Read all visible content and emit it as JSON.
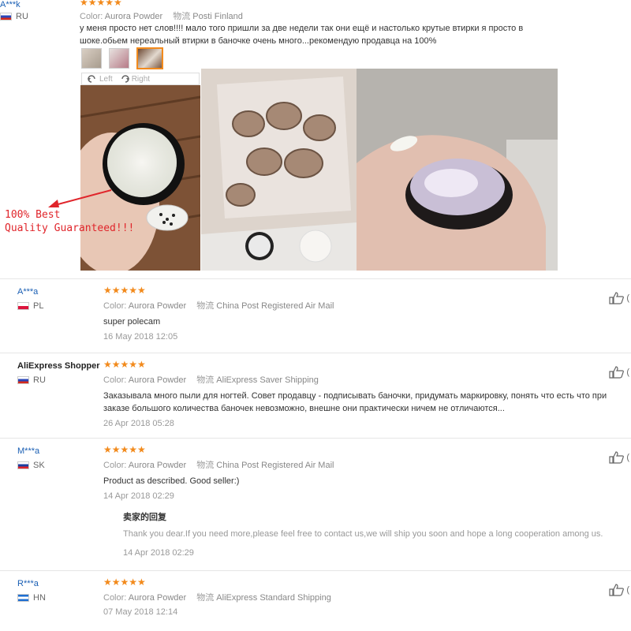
{
  "top_review": {
    "user": "A***k",
    "country": "RU",
    "stars": "★★★★★",
    "color_label": "Color:",
    "color": "Aurora Powder",
    "shipping_label": "物流",
    "shipping": "Posti Finland",
    "text": "у меня просто нет слов!!!! мало того пришли за две недели так они ещё и настолько крутые втирки я просто в шоке.обьем нереальный втирки в баночке очень много...рекомендую продавца на 100%",
    "rotate_left": "Left",
    "rotate_right": "Right"
  },
  "promo": {
    "line1": "100% Best",
    "line2": "Quality Guaranteed!!!"
  },
  "reviews": [
    {
      "user": "A***a",
      "country": "PL",
      "stars": "★★★★★",
      "color_label": "Color:",
      "color": "Aurora Powder",
      "shipping_label": "物流",
      "shipping": "China Post Registered Air Mail",
      "text": "super polecam",
      "date": "16 May 2018 12:05"
    },
    {
      "user": "AliExpress Shopper",
      "country": "RU",
      "stars": "★★★★★",
      "color_label": "Color:",
      "color": "Aurora Powder",
      "shipping_label": "物流",
      "shipping": "AliExpress Saver Shipping",
      "text": "Заказывала много пыли для ногтей. Совет продавцу - подписывать баночки, придумать маркировку, понять что есть что при заказе большого количества баночек невозможно, внешне они практически ничем не отличаются...",
      "date": "26 Apr 2018 05:28"
    },
    {
      "user": "M***a",
      "country": "SK",
      "stars": "★★★★★",
      "color_label": "Color:",
      "color": "Aurora Powder",
      "shipping_label": "物流",
      "shipping": "China Post Registered Air Mail",
      "text": "Product as described. Good seller:)",
      "date": "14 Apr 2018 02:29",
      "reply_title": "卖家的回复",
      "reply_text": "Thank you dear.If you need more,please feel free to contact us,we will ship you soon and hope a long cooperation among us.",
      "reply_date": "14 Apr 2018 02:29"
    },
    {
      "user": "R***a",
      "country": "HN",
      "stars": "★★★★★",
      "color_label": "Color:",
      "color": "Aurora Powder",
      "shipping_label": "物流",
      "shipping": "AliExpress Standard Shipping",
      "date": "07 May 2018 12:14"
    }
  ],
  "like_count": "(",
  "icons": {
    "like": "thumbs-up-icon",
    "rotate_left": "rotate-left-icon",
    "rotate_right": "rotate-right-icon"
  },
  "colors": {
    "star": "#f28a1c",
    "username": "#1a5fb4",
    "promo": "#e0252b"
  }
}
